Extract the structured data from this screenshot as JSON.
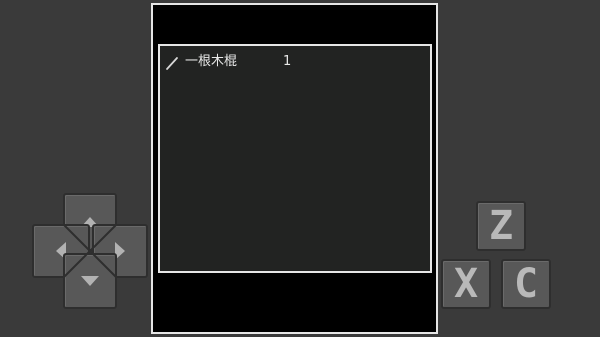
{
  "inventory": {
    "items": [
      {
        "icon": "stick-icon",
        "name": "一根木棍",
        "count": "1"
      }
    ]
  },
  "controls": {
    "dpad": {
      "up": "arrow-up-icon",
      "down": "arrow-down-icon",
      "left": "arrow-left-icon",
      "right": "arrow-right-icon"
    },
    "buttons": {
      "z": "Z",
      "x": "X",
      "c": "C"
    }
  },
  "colors": {
    "background": "#3a3a3a",
    "screen": "#000000",
    "panel": "#222322",
    "border": "#e6e6e6",
    "button": "#585858",
    "button_glyph": "#b9b9b9"
  }
}
